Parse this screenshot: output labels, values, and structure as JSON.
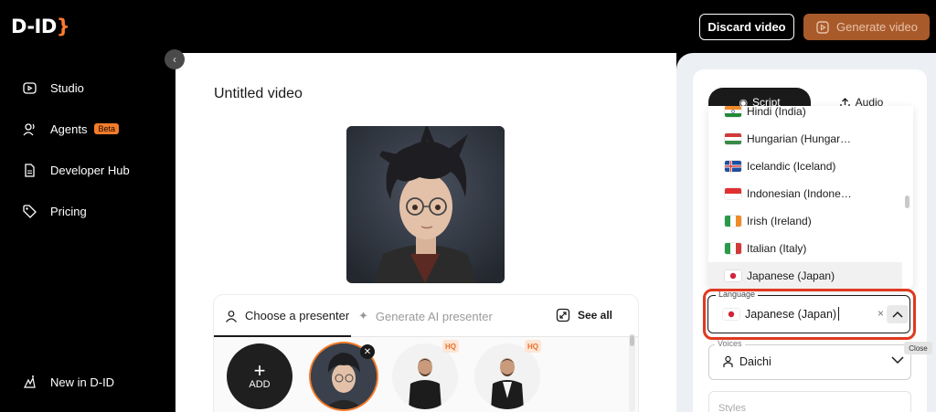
{
  "brand": {
    "name": "D-ID",
    "accent": "#f47b2a"
  },
  "header": {
    "discard_label": "Discard video",
    "generate_label": "Generate video"
  },
  "sidebar": {
    "items": [
      {
        "label": "Studio",
        "icon": "studio-icon"
      },
      {
        "label": "Agents",
        "icon": "agents-icon",
        "badge": "Beta"
      },
      {
        "label": "Developer Hub",
        "icon": "document-icon"
      },
      {
        "label": "Pricing",
        "icon": "tag-icon"
      }
    ],
    "footer_label": "New in D-ID"
  },
  "main": {
    "title": "Untitled video",
    "presenter_tabs": {
      "choose_label": "Choose a presenter",
      "generate_label": "Generate AI presenter",
      "see_all_label": "See all"
    },
    "add_label": "ADD",
    "hq_badge": "HQ"
  },
  "right": {
    "tabs": {
      "script_label": "Script",
      "audio_label": "Audio"
    },
    "language_options": [
      {
        "label": "Hindi (India)",
        "flag": "india"
      },
      {
        "label": "Hungarian (Hungar…",
        "flag": "hungary"
      },
      {
        "label": "Icelandic (Iceland)",
        "flag": "iceland"
      },
      {
        "label": "Indonesian (Indone…",
        "flag": "indonesia"
      },
      {
        "label": "Irish (Ireland)",
        "flag": "ireland"
      },
      {
        "label": "Italian (Italy)",
        "flag": "italy"
      },
      {
        "label": "Japanese (Japan)",
        "flag": "japan"
      }
    ],
    "language": {
      "legend": "Language",
      "value": "Japanese (Japan)",
      "clear": "×",
      "tooltip": "Close"
    },
    "voices": {
      "legend": "Voices",
      "value": "Daichi"
    },
    "styles": {
      "placeholder": "Styles"
    }
  }
}
